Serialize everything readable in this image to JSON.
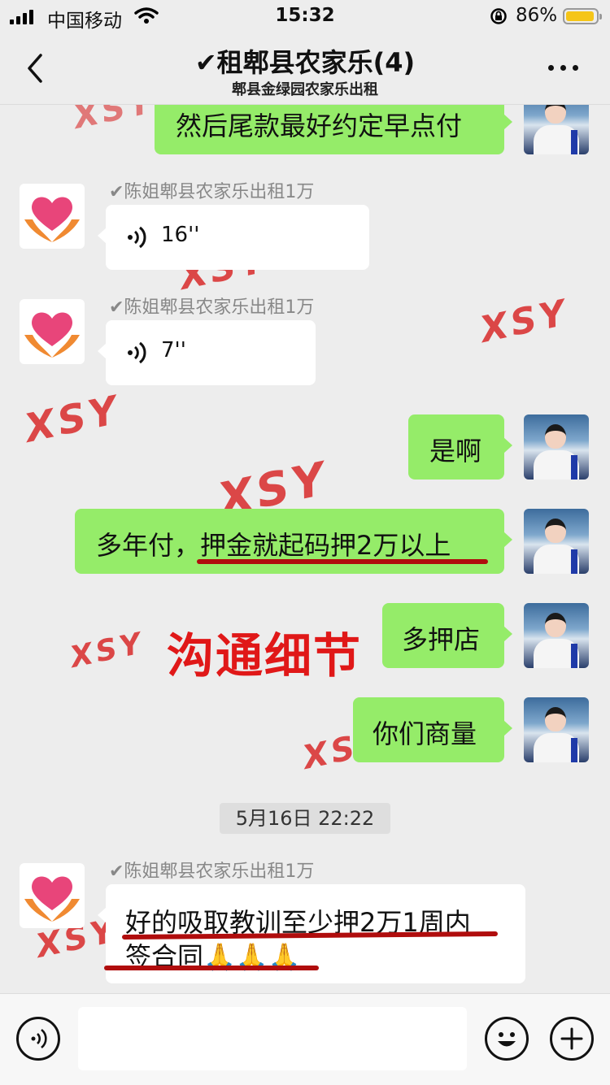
{
  "status_bar": {
    "carrier": "中国移动",
    "time": "15:32",
    "battery_percent": "86%",
    "battery_level": 0.86
  },
  "header": {
    "title": "✔租郫县农家乐(4)",
    "subtitle": "郫县金绿园农家乐出租"
  },
  "messages": [
    {
      "side": "me",
      "text": "然后尾款最好约定早点付"
    },
    {
      "side": "other",
      "sender": "✔陈姐郫县农家乐出租1万",
      "type": "voice",
      "duration": "16''"
    },
    {
      "side": "other",
      "sender": "✔陈姐郫县农家乐出租1万",
      "type": "voice",
      "duration": "7''"
    },
    {
      "side": "me",
      "text": "是啊"
    },
    {
      "side": "me",
      "text": "多年付，押金就起码押2万以上"
    },
    {
      "side": "me",
      "text": "多押店"
    },
    {
      "side": "me",
      "text": "你们商量"
    },
    {
      "side": "other",
      "sender": "✔陈姐郫县农家乐出租1万",
      "text_line1": "好的吸取教训至少押2万1周内",
      "text_line2": "签合同🙏🙏🙏"
    }
  ],
  "timestamp": "5月16日 22:22",
  "overlay_label": "沟通细节",
  "watermark": "XSY",
  "icons": {
    "back": "chevron-left-icon",
    "more": "more-dots-icon",
    "voice": "voice-wave-icon",
    "emoji": "emoji-icon",
    "add": "plus-icon",
    "avatar_other": "heart-hands-icon"
  },
  "colors": {
    "bubble_me": "#95ec69",
    "bubble_other": "#ffffff",
    "background": "#ededed",
    "annotation_red": "#e01818"
  },
  "input": {
    "placeholder": ""
  }
}
